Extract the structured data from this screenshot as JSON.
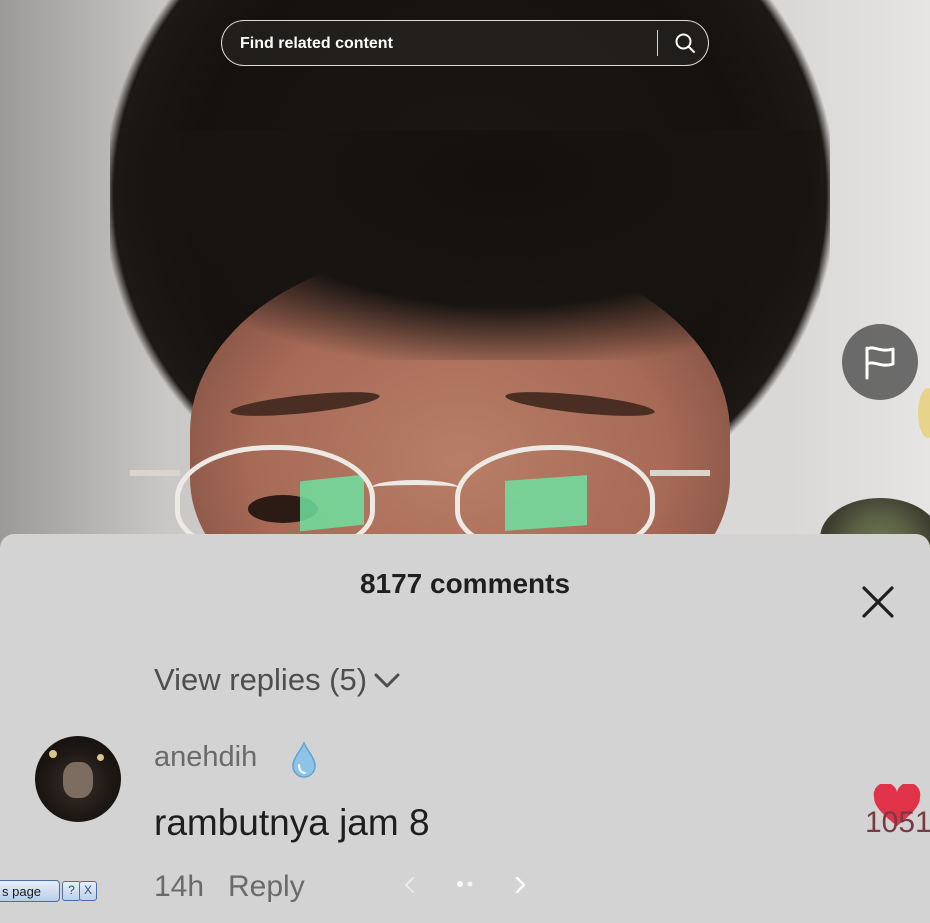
{
  "search": {
    "placeholder": "Find related content",
    "icon": "search-icon"
  },
  "side_actions": {
    "flag_icon": "flag-icon"
  },
  "comments": {
    "count_label": "8177 comments",
    "close_icon": "close-icon",
    "view_replies_label": "View replies (5)",
    "chevron_icon": "chevron-down-icon",
    "items": [
      {
        "username": "anehdih",
        "badge_icon": "water-drop-icon",
        "text": "rambutnya jam 8",
        "time": "14h",
        "reply_label": "Reply",
        "like_count": "1051",
        "like_icon": "heart-icon"
      }
    ]
  },
  "pager": {
    "prev_icon": "chevron-left-icon",
    "next_icon": "chevron-right-icon"
  },
  "taskbar": {
    "page_label": "s page",
    "help_label": "?",
    "close_label": "X"
  },
  "colors": {
    "like_red": "#e0334a",
    "sheet_bg": "#d3d3d3"
  }
}
